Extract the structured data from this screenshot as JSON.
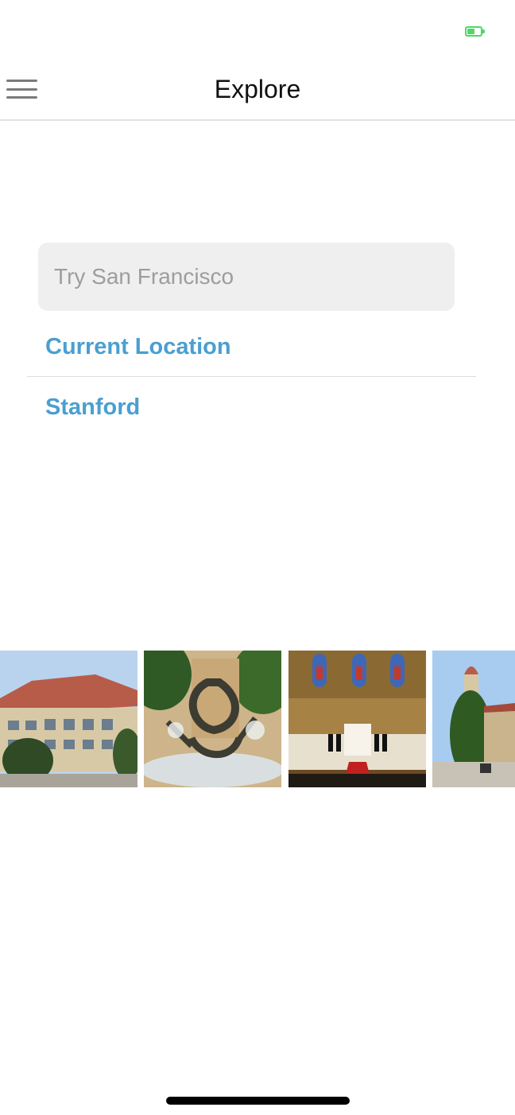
{
  "status_bar": {
    "battery_icon": "battery-charging-icon",
    "battery_color": "#4cd964"
  },
  "nav": {
    "title": "Explore",
    "menu_icon": "hamburger-menu-icon"
  },
  "search": {
    "placeholder": "Try San Francisco",
    "value": ""
  },
  "locations": [
    {
      "label": "Current Location"
    },
    {
      "label": "Stanford"
    }
  ],
  "colors": {
    "accent": "#4a9fd0",
    "search_bg": "#efefef",
    "divider": "#dcdcdc"
  },
  "photos": [
    {
      "name": "building-photo"
    },
    {
      "name": "fountain-sculpture-photo"
    },
    {
      "name": "church-interior-photo"
    },
    {
      "name": "tower-campus-photo"
    }
  ]
}
